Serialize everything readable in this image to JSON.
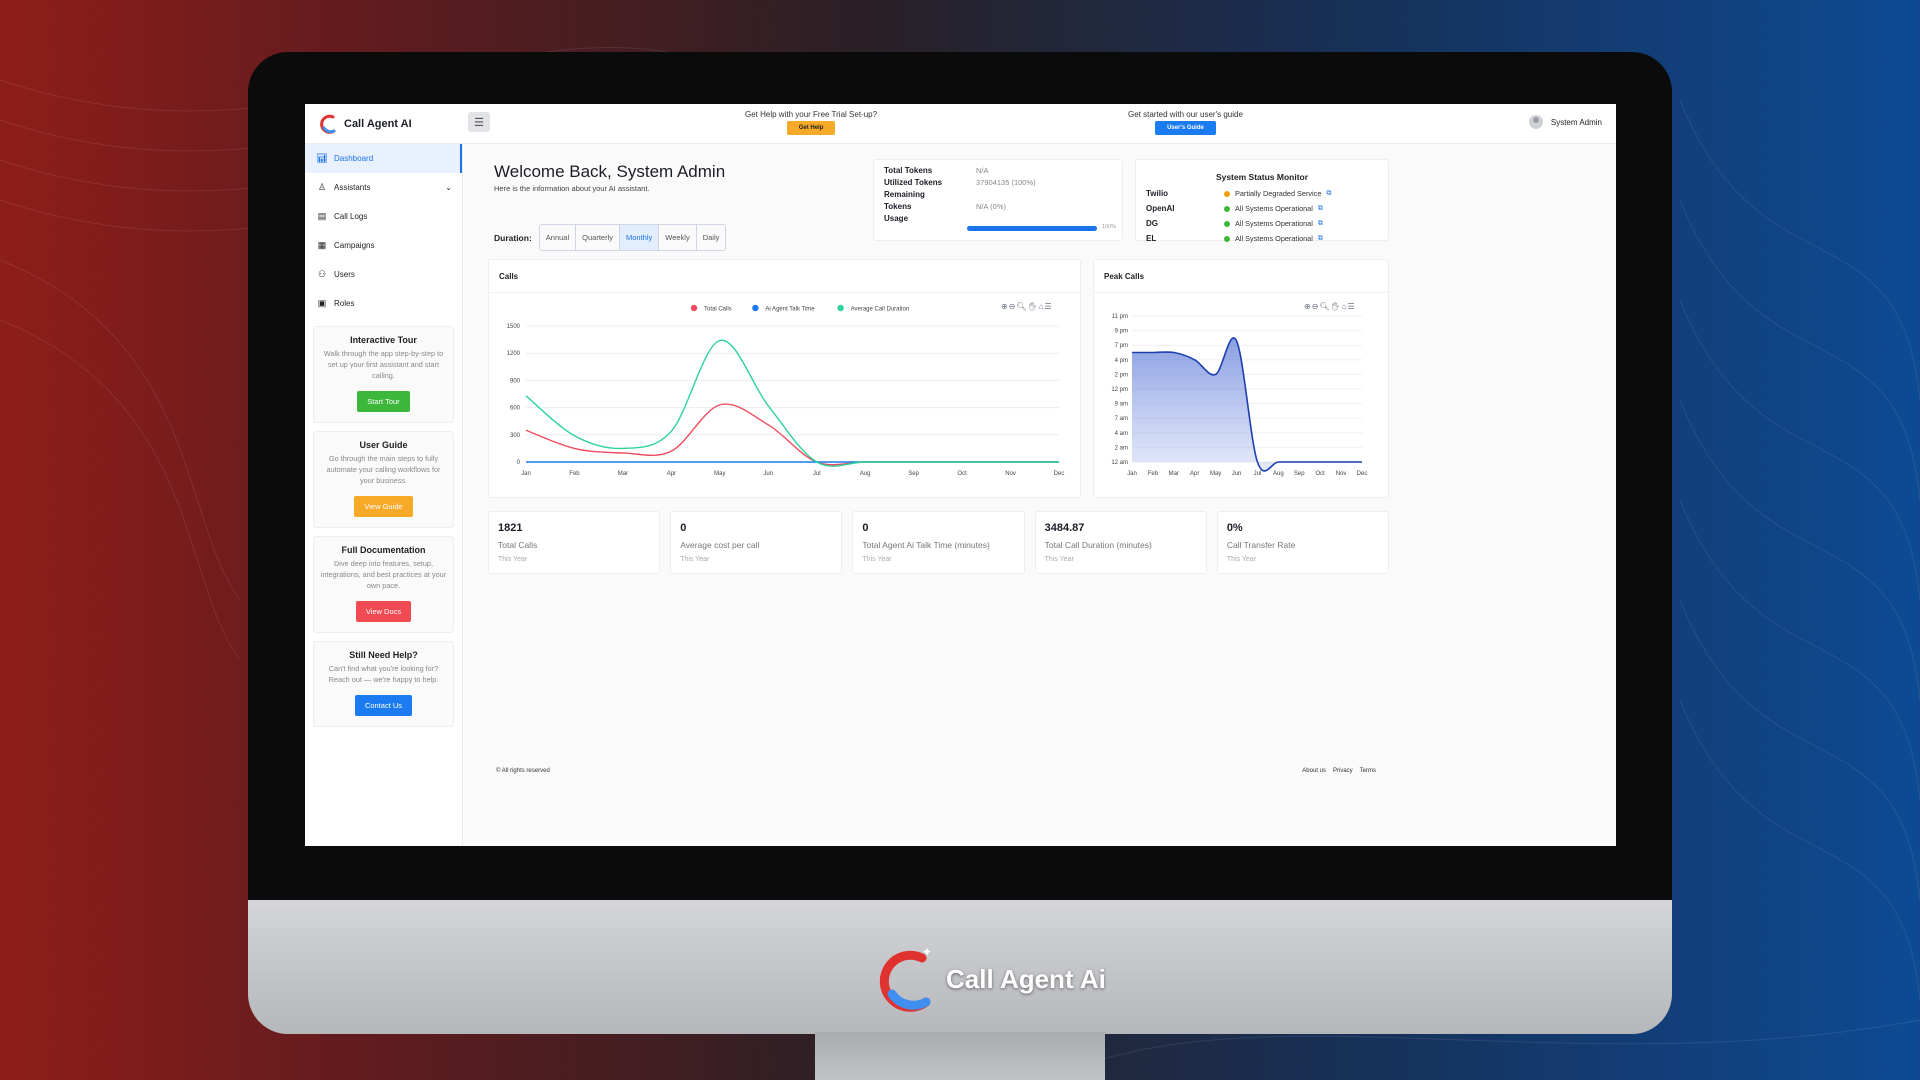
{
  "brand": {
    "name": "Call Agent AI",
    "chin_name": "Call Agent Ai"
  },
  "topbar": {
    "help_text": "Get Help with your Free Trial Set-up?",
    "help_button": "Get Help",
    "guide_text": "Get started with our user's guide",
    "guide_button": "User's Guide",
    "user_name": "System Admin"
  },
  "sidebar": {
    "items": [
      {
        "label": "Dashboard",
        "icon": "chart-icon"
      },
      {
        "label": "Assistants",
        "icon": "user-icon"
      },
      {
        "label": "Call Logs",
        "icon": "log-icon"
      },
      {
        "label": "Campaigns",
        "icon": "campaign-icon"
      },
      {
        "label": "Users",
        "icon": "users-icon"
      },
      {
        "label": "Roles",
        "icon": "roles-icon"
      }
    ],
    "cards": [
      {
        "title": "Interactive Tour",
        "text": "Walk through the app step-by-step to set up your first assistant and start calling.",
        "button": "Start Tour"
      },
      {
        "title": "User Guide",
        "text": "Go through the main steps to fully automate your calling workflows for your business.",
        "button": "View Guide"
      },
      {
        "title": "Full Documentation",
        "text": "Dive deep into features, setup, integrations, and best practices at your own pace.",
        "button": "View Docs"
      },
      {
        "title": "Still Need Help?",
        "text": "Can't find what you're looking for? Reach out — we're happy to help.",
        "button": "Contact Us"
      }
    ]
  },
  "welcome": {
    "title": "Welcome Back, System Admin",
    "subtitle": "Here is the information about your AI assistant."
  },
  "duration": {
    "label": "Duration:",
    "options": [
      "Annual",
      "Quarterly",
      "Monthly",
      "Weekly",
      "Daily"
    ],
    "selected": "Monthly"
  },
  "tokens": {
    "total_label": "Total Tokens",
    "total_value": "N/A",
    "utilized_label": "Utilized Tokens",
    "utilized_value": "37904135 (100%)",
    "remaining_label": "Remaining",
    "tokens_label": "Tokens",
    "remaining_value": "N/A (0%)",
    "usage_label": "Usage",
    "usage_percent": "100%",
    "usage_fraction": 1.0
  },
  "status": {
    "title": "System Status Monitor",
    "services": [
      {
        "name": "Twilio",
        "state": "Partially Degraded Service",
        "color": "#f59e0b"
      },
      {
        "name": "OpenAI",
        "state": "All Systems Operational",
        "color": "#3cb73a"
      },
      {
        "name": "DG",
        "state": "All Systems Operational",
        "color": "#3cb73a"
      },
      {
        "name": "EL",
        "state": "All Systems Operational",
        "color": "#3cb73a"
      }
    ]
  },
  "calls_panel": {
    "title": "Calls"
  },
  "peak_panel": {
    "title": "Peak Calls"
  },
  "chart_data": [
    {
      "type": "line",
      "title": "Calls",
      "categories": [
        "Jan",
        "Feb",
        "Mar",
        "Apr",
        "May",
        "Jun",
        "Jul",
        "Aug",
        "Sep",
        "Oct",
        "Nov",
        "Dec"
      ],
      "yticks": [
        0,
        300,
        600,
        900,
        1200,
        1500
      ],
      "ylim": [
        0,
        1500
      ],
      "legend": "top-center",
      "series": [
        {
          "name": "Total Calls",
          "color": "#ef4a5f",
          "values": [
            350,
            150,
            100,
            120,
            630,
            410,
            0,
            0,
            0,
            0,
            0,
            0
          ]
        },
        {
          "name": "Ai Agent Talk Time",
          "color": "#1a7cf0",
          "values": [
            0,
            0,
            0,
            0,
            0,
            0,
            0,
            0,
            0,
            0,
            0,
            0
          ]
        },
        {
          "name": "Average Call Duration",
          "color": "#2ed39a",
          "values": [
            730,
            290,
            150,
            340,
            1340,
            620,
            0,
            0,
            0,
            0,
            0,
            0
          ]
        }
      ]
    },
    {
      "type": "area",
      "title": "Peak Calls",
      "categories": [
        "Jan",
        "Feb",
        "Mar",
        "Apr",
        "May",
        "Jun",
        "Jul",
        "Aug",
        "Sep",
        "Oct",
        "Nov",
        "Dec"
      ],
      "yticks": [
        "12 am",
        "2 am",
        "4 am",
        "7 am",
        "9 am",
        "12 pm",
        "2 pm",
        "4 pm",
        "7 pm",
        "9 pm",
        "11 pm"
      ],
      "ylim": [
        0,
        10
      ],
      "series": [
        {
          "name": "",
          "color": "#1d3fb0",
          "values": [
            7.5,
            7.5,
            7.5,
            7,
            6,
            8.3,
            0,
            0,
            0,
            0,
            0,
            0
          ]
        }
      ]
    }
  ],
  "stats": [
    {
      "value": "1821",
      "label": "Total Calls",
      "sub": "This Year"
    },
    {
      "value": "0",
      "label": "Average cost per call",
      "sub": "This Year"
    },
    {
      "value": "0",
      "label": "Total Agent Ai Talk Time (minutes)",
      "sub": "This Year"
    },
    {
      "value": "3484.87",
      "label": "Total Call Duration (minutes)",
      "sub": "This Year"
    },
    {
      "value": "0%",
      "label": "Call Transfer Rate",
      "sub": "This Year"
    }
  ],
  "footer": {
    "copyright": "© All rights reserved",
    "links": [
      "About us",
      "Privacy",
      "Terms"
    ]
  }
}
